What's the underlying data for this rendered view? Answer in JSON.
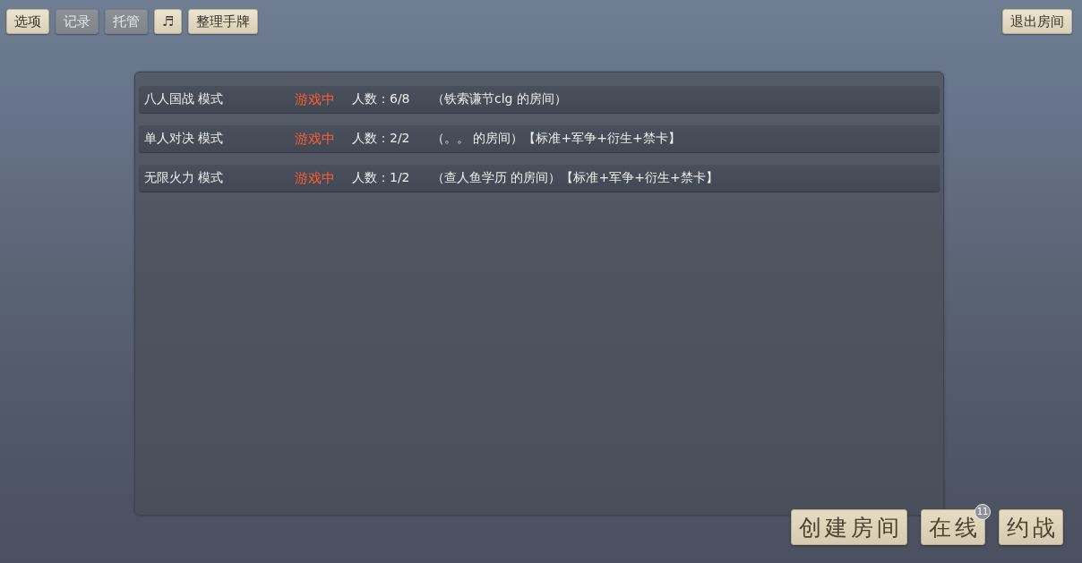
{
  "toolbar": {
    "buttons": [
      {
        "label": "选项",
        "disabled": false
      },
      {
        "label": "记录",
        "disabled": true
      },
      {
        "label": "托管",
        "disabled": true
      },
      {
        "label": "♬",
        "disabled": false
      },
      {
        "label": "整理手牌",
        "disabled": false
      }
    ],
    "exit_button": {
      "label": "退出房间"
    }
  },
  "rooms": [
    {
      "mode": "八人国战 模式",
      "status": "游戏中",
      "players": "人数：6/8",
      "room": "（铁索谦节clg 的房间）"
    },
    {
      "mode": "单人对决 模式",
      "status": "游戏中",
      "players": "人数：2/2",
      "room": "（。。 的房间）【标准+军争+衍生+禁卡】"
    },
    {
      "mode": "无限火力 模式",
      "status": "游戏中",
      "players": "人数：1/2",
      "room": "（查人鱼学历 的房间）【标准+军争+衍生+禁卡】"
    }
  ],
  "actions": [
    {
      "label": "创建房间"
    },
    {
      "label": "在线",
      "badge": "11"
    },
    {
      "label": "约战"
    }
  ]
}
